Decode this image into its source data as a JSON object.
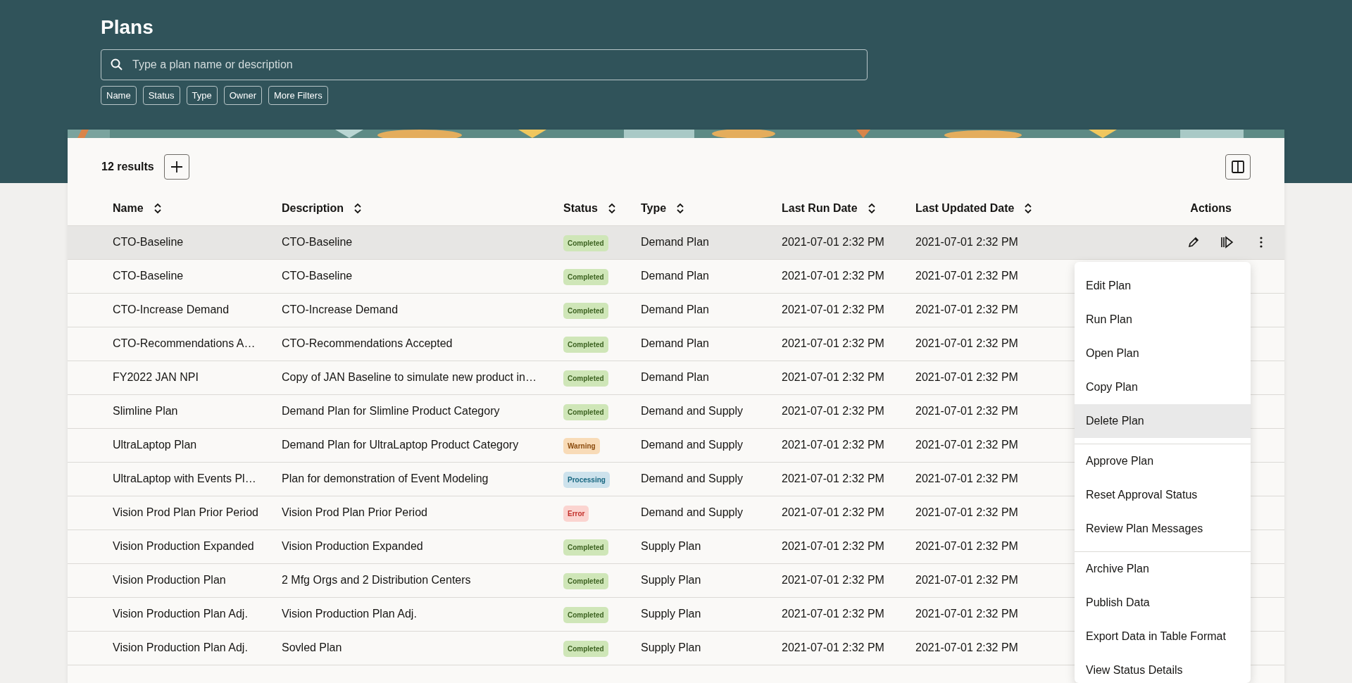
{
  "page": {
    "title": "Plans"
  },
  "search": {
    "placeholder": "Type a plan name or description"
  },
  "filters": [
    "Name",
    "Status",
    "Type",
    "Owner",
    "More Filters"
  ],
  "results": {
    "count": "12 results"
  },
  "table": {
    "columns": [
      {
        "label": "Name",
        "sortable": true
      },
      {
        "label": "Description",
        "sortable": true
      },
      {
        "label": "Status",
        "sortable": true
      },
      {
        "label": "Type",
        "sortable": true
      },
      {
        "label": "Last Run Date",
        "sortable": true
      },
      {
        "label": "Last Updated Date",
        "sortable": true
      },
      {
        "label": "Actions",
        "sortable": false
      }
    ],
    "rows": [
      {
        "name": "CTO-Baseline",
        "description": "CTO-Baseline",
        "status": {
          "label": "Completed",
          "kind": "success"
        },
        "type": "Demand Plan",
        "last_run": "2021-07-01 2:32 PM",
        "last_updated": "2021-07-01 2:32 PM",
        "selected": true
      },
      {
        "name": "CTO-Baseline",
        "description": "CTO-Baseline",
        "status": {
          "label": "Completed",
          "kind": "success"
        },
        "type": "Demand Plan",
        "last_run": "2021-07-01 2:32 PM",
        "last_updated": "2021-07-01 2:32 PM",
        "selected": false
      },
      {
        "name": "CTO-Increase Demand",
        "description": "CTO-Increase Demand",
        "status": {
          "label": "Completed",
          "kind": "success"
        },
        "type": "Demand Plan",
        "last_run": "2021-07-01 2:32 PM",
        "last_updated": "2021-07-01 2:32 PM",
        "selected": false
      },
      {
        "name": "CTO-Recommendations A…",
        "description": "CTO-Recommendations Accepted",
        "status": {
          "label": "Completed",
          "kind": "success"
        },
        "type": "Demand Plan",
        "last_run": "2021-07-01 2:32 PM",
        "last_updated": "2021-07-01 2:32 PM",
        "selected": false
      },
      {
        "name": "FY2022 JAN NPI",
        "description": "Copy of JAN Baseline to simulate new product in…",
        "status": {
          "label": "Completed",
          "kind": "success"
        },
        "type": "Demand Plan",
        "last_run": "2021-07-01 2:32 PM",
        "last_updated": "2021-07-01 2:32 PM",
        "selected": false
      },
      {
        "name": "Slimline Plan",
        "description": "Demand Plan for Slimline Product Category",
        "status": {
          "label": "Completed",
          "kind": "success"
        },
        "type": "Demand and Supply",
        "last_run": "2021-07-01 2:32 PM",
        "last_updated": "2021-07-01 2:32 PM",
        "selected": false
      },
      {
        "name": "UltraLaptop Plan",
        "description": "Demand Plan for UltraLaptop Product Category",
        "status": {
          "label": "Warning",
          "kind": "warning"
        },
        "type": "Demand and Supply",
        "last_run": "2021-07-01 2:32 PM",
        "last_updated": "2021-07-01 2:32 PM",
        "selected": false
      },
      {
        "name": "UltraLaptop with Events Pl…",
        "description": "Plan for demonstration of Event Modeling",
        "status": {
          "label": "Processing",
          "kind": "info"
        },
        "type": "Demand and Supply",
        "last_run": "2021-07-01 2:32 PM",
        "last_updated": "2021-07-01 2:32 PM",
        "selected": false
      },
      {
        "name": "Vision Prod Plan Prior Period",
        "description": "Vision Prod Plan Prior Period",
        "status": {
          "label": "Error",
          "kind": "error"
        },
        "type": "Demand and Supply",
        "last_run": "2021-07-01 2:32 PM",
        "last_updated": "2021-07-01 2:32 PM",
        "selected": false
      },
      {
        "name": "Vision Production Expanded",
        "description": "Vision Production Expanded",
        "status": {
          "label": "Completed",
          "kind": "success"
        },
        "type": "Supply Plan",
        "last_run": "2021-07-01 2:32 PM",
        "last_updated": "2021-07-01 2:32 PM",
        "selected": false
      },
      {
        "name": "Vision Production Plan",
        "description": "2 Mfg Orgs and 2 Distribution Centers",
        "status": {
          "label": "Completed",
          "kind": "success"
        },
        "type": "Supply Plan",
        "last_run": "2021-07-01 2:32 PM",
        "last_updated": "2021-07-01 2:32 PM",
        "selected": false
      },
      {
        "name": "Vision Production Plan Adj.",
        "description": "Vision Production Plan Adj.",
        "status": {
          "label": "Completed",
          "kind": "success"
        },
        "type": "Supply Plan",
        "last_run": "2021-07-01 2:32 PM",
        "last_updated": "2021-07-01 2:32 PM",
        "selected": false
      },
      {
        "name": "Vision Production Plan Adj.",
        "description": "Sovled Plan",
        "status": {
          "label": "Completed",
          "kind": "success"
        },
        "type": "Supply Plan",
        "last_run": "2021-07-01 2:32 PM",
        "last_updated": "2021-07-01 2:32 PM",
        "selected": false
      }
    ]
  },
  "menu": {
    "sections": [
      [
        {
          "label": "Edit Plan",
          "selected": false
        },
        {
          "label": "Run Plan",
          "selected": false
        },
        {
          "label": "Open Plan",
          "selected": false
        },
        {
          "label": "Copy Plan",
          "selected": false
        },
        {
          "label": "Delete Plan",
          "selected": true
        }
      ],
      [
        {
          "label": "Approve Plan",
          "selected": false
        },
        {
          "label": "Reset Approval Status",
          "selected": false
        },
        {
          "label": "Review Plan Messages",
          "selected": false
        }
      ],
      [
        {
          "label": "Archive Plan",
          "selected": false
        },
        {
          "label": "Publish Data",
          "selected": false
        },
        {
          "label": "Export Data in Table Format",
          "selected": false
        },
        {
          "label": "View Status Details",
          "selected": false
        }
      ]
    ]
  }
}
